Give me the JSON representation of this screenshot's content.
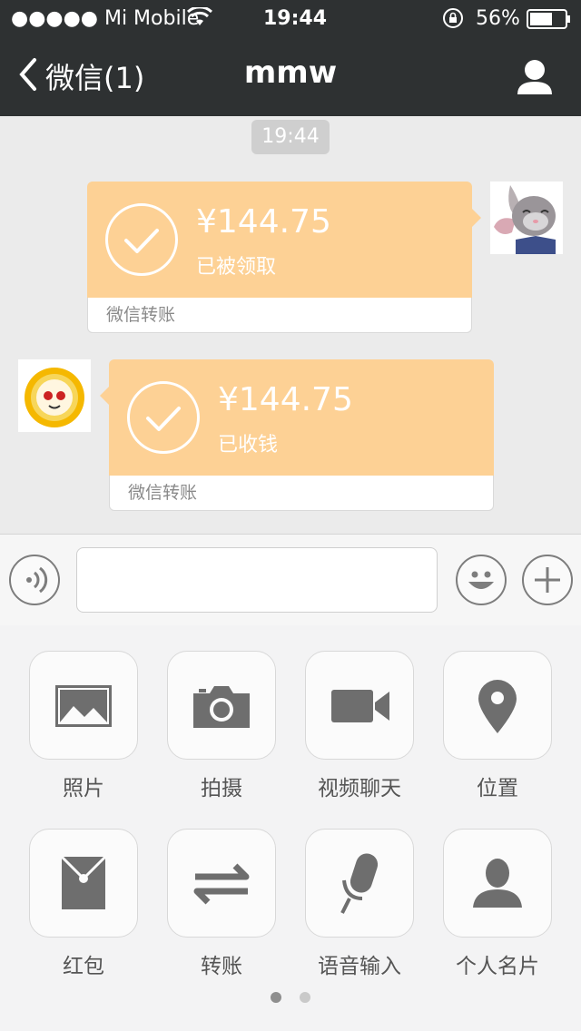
{
  "status_bar": {
    "carrier": "●●●●● Mi Mobile",
    "time": "19:44",
    "battery": "56%"
  },
  "nav": {
    "back_label": "微信(1)",
    "title": "mmw"
  },
  "chat": {
    "timestamp": "19:44",
    "messages": [
      {
        "amount": "¥144.75",
        "status": "已被领取",
        "footer": "微信转账"
      },
      {
        "amount": "¥144.75",
        "status": "已收钱",
        "footer": "微信转账"
      }
    ]
  },
  "input": {
    "placeholder": ""
  },
  "panel": {
    "items": [
      {
        "label": "照片",
        "icon": "photo-icon"
      },
      {
        "label": "拍摄",
        "icon": "camera-icon"
      },
      {
        "label": "视频聊天",
        "icon": "video-icon"
      },
      {
        "label": "位置",
        "icon": "location-icon"
      },
      {
        "label": "红包",
        "icon": "red-packet-icon"
      },
      {
        "label": "转账",
        "icon": "transfer-icon"
      },
      {
        "label": "语音输入",
        "icon": "microphone-icon"
      },
      {
        "label": "个人名片",
        "icon": "contact-card-icon"
      }
    ],
    "page_indicator": {
      "pages": 2,
      "current": 1
    }
  },
  "colors": {
    "bar": "#2e3132",
    "bubble": "#fdd195",
    "icon": "#6e6e6e"
  }
}
